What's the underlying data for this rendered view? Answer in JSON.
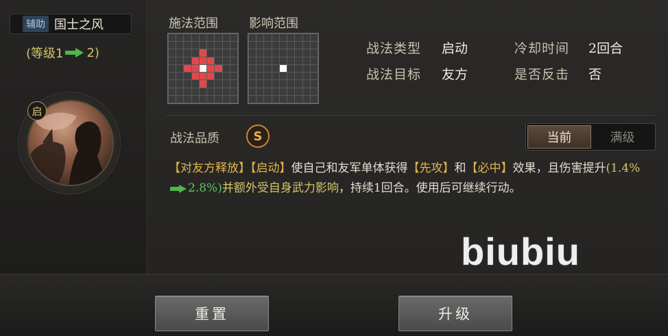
{
  "skill": {
    "type_badge": "辅助",
    "name": "国士之风",
    "level_prefix": "(等级1",
    "level_suffix": "2)",
    "activation_badge": "启"
  },
  "ranges": {
    "cast_label": "施法范围",
    "effect_label": "影响范围"
  },
  "info": {
    "tactic_type_key": "战法类型",
    "tactic_type_val": "启动",
    "cooldown_key": "冷却时间",
    "cooldown_val": "2回合",
    "target_key": "战法目标",
    "target_val": "友方",
    "counter_key": "是否反击",
    "counter_val": "否"
  },
  "quality": {
    "label": "战法品质",
    "grade": "S"
  },
  "toggle": {
    "current": "当前",
    "max": "满级"
  },
  "description": {
    "tag1": "【对友方释放】",
    "tag2": "【启动】",
    "text1": "使自己和友军单体获得",
    "tag3": "【先攻】",
    "text2": "和",
    "tag4": "【必中】",
    "text3": "效果，且伤害提升",
    "num_from": "(1.4%",
    "num_to": "2.8%)",
    "text4": "并额外受自身武力影响",
    "text5": "，持续1回合。使用后可继续行动。"
  },
  "watermark": "biubiu",
  "buttons": {
    "reset": "重置",
    "upgrade": "升级"
  },
  "colors": {
    "range_red": "#e2474c",
    "accent_gold": "#e3b64c",
    "arrow_green": "#4fb64a"
  }
}
